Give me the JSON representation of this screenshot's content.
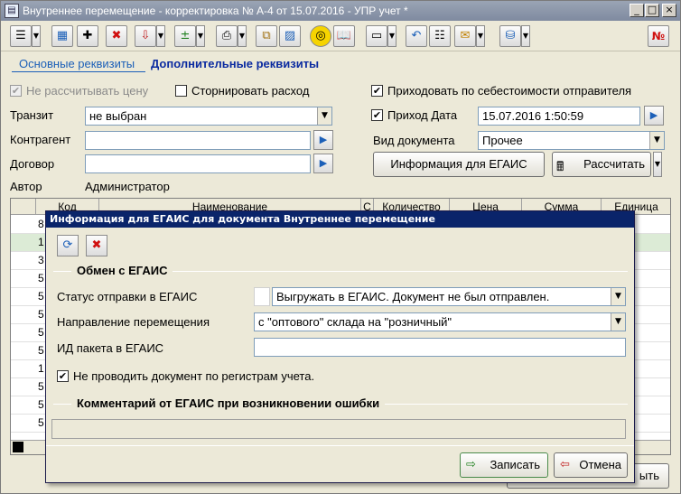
{
  "window": {
    "title": "Внутреннее перемещение - корректировка № А-4 от 15.07.2016 - УПР учет *",
    "minimize": "_",
    "maximize": "□",
    "close": "×"
  },
  "toolbar": {
    "right_badge": "№"
  },
  "tabs": {
    "main": "Основные реквизиты",
    "extra": "Дополнительные реквизиты"
  },
  "form": {
    "no_calc_price": "Не рассчитывать цену",
    "storno": "Сторнировать расход",
    "by_cost": "Приходовать по себестоимости отправителя",
    "transit_label": "Транзит",
    "transit_value": "не выбран",
    "income_date_label": "Приход Дата",
    "income_date_value": "15.07.2016 1:50:59",
    "contragent_label": "Контрагент",
    "doc_type_label": "Вид документа",
    "doc_type_value": "Прочее",
    "contract_label": "Договор",
    "egais_info_button": "Информация для ЕГАИС",
    "calc_button": "Рассчитать",
    "author_label": "Автор",
    "author_value": "Администратор"
  },
  "grid": {
    "columns": [
      "",
      "Код",
      "Наименование",
      "С",
      "Количество",
      "Цена",
      "Сумма",
      "Единица"
    ],
    "row_numbers": [
      "8",
      "1",
      "3",
      "5",
      "5",
      "5",
      "5",
      "5",
      "1",
      "5",
      "5",
      "5"
    ]
  },
  "bottom": {
    "close_partial": "ыть"
  },
  "dialog": {
    "title": "Информация для ЕГАИС для документа Внутреннее перемещение",
    "group1": "Обмен с ЕГАИС",
    "status_label": "Статус отправки в ЕГАИС",
    "status_value": "Выгружать в ЕГАИС. Документ не был отправлен.",
    "direction_label": "Направление перемещения",
    "direction_value": "с \"оптового\" склада на \"розничный\"",
    "packet_label": "ИД пакета в ЕГАИС",
    "packet_value": "",
    "no_registers": "Не проводить документ по регистрам учета.",
    "group2": "Комментарий от ЕГАИС при возникновении ошибки",
    "comment_value": "",
    "save_button": "Записать",
    "cancel_button": "Отмена"
  }
}
